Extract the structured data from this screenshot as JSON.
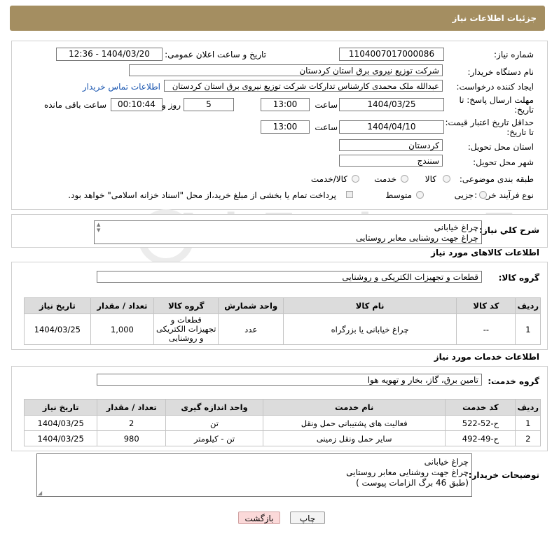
{
  "header": {
    "title": "جزئیات اطلاعات نیاز"
  },
  "watermark": {
    "text": "AriaTender.neT"
  },
  "form": {
    "need_number_label": "شماره نیاز:",
    "need_number": "1104007017000086",
    "announce_label": "تاریخ و ساعت اعلان عمومی:",
    "announce_value": "1404/03/20 - 12:36",
    "buyer_org_label": "نام دستگاه خریدار:",
    "buyer_org": "شرکت توزیع نیروی برق استان کردستان",
    "creator_label": "ایجاد کننده درخواست:",
    "creator": "عبدالله ملک محمدی کارشناس تدارکات شرکت توزیع نیروی برق استان کردستان",
    "contact_link": "اطلاعات تماس خریدار",
    "deadline_label_1": "مهلت ارسال پاسخ: تا",
    "deadline_label_2": "تاریخ:",
    "deadline_date": "1404/03/25",
    "time_label": "ساعت",
    "deadline_time": "13:00",
    "days_value": "5",
    "days_label": "روز و",
    "remaining_value": "00:10:44",
    "remaining_label": "ساعت باقی مانده",
    "validity_label_1": "حداقل تاریخ اعتبار قیمت:",
    "validity_label_2": "تا تاریخ:",
    "validity_date": "1404/04/10",
    "validity_time": "13:00",
    "province_label": "استان محل تحویل:",
    "province": "کردستان",
    "city_label": "شهر محل تحویل:",
    "city": "سنندج",
    "category_label": "طبقه بندی موضوعی:",
    "category_options": [
      "کالا",
      "خدمت",
      "کالا/خدمت"
    ],
    "process_label": "نوع فرآیند خرید :",
    "process_options": [
      "جزیی",
      "متوسط"
    ],
    "payment_note": "پرداخت تمام یا بخشی از مبلغ خرید،از محل \"اسناد خزانه اسلامی\" خواهد بود."
  },
  "summary": {
    "label": "شرح كلي نياز:",
    "line1": "چراغ خیابانی",
    "line2": "چراغ جهت روشنایی معابر روستایی"
  },
  "goods": {
    "section_title": "اطلاعات کالاهای مورد نیاز",
    "group_label": "گروه کالا:",
    "group_value": "قطعات و تجهیزات الکتریکی و روشنایی",
    "headers": [
      "ردیف",
      "کد کالا",
      "نام کالا",
      "واحد شمارش",
      "گروه کالا",
      "تعداد / مقدار",
      "تاریخ نیاز"
    ],
    "rows": [
      {
        "idx": "1",
        "code": "--",
        "name": "چراغ خیابانی یا بزرگراه",
        "unit": "عدد",
        "group": "قطعات و تجهیزات الکتریکی و روشنایی",
        "qty": "1,000",
        "date": "1404/03/25"
      }
    ]
  },
  "services": {
    "section_title": "اطلاعات خدمات مورد نیاز",
    "group_label": "گروه خدمت:",
    "group_value": "تامین برق، گاز، بخار و تهویه هوا",
    "headers": [
      "ردیف",
      "کد خدمت",
      "نام خدمت",
      "واحد اندازه گیری",
      "تعداد / مقدار",
      "تاریخ نیاز"
    ],
    "rows": [
      {
        "idx": "1",
        "code": "ح-52-522",
        "name": "فعالیت های پشتیبانی حمل ونقل",
        "unit": "تن",
        "qty": "2",
        "date": "1404/03/25"
      },
      {
        "idx": "2",
        "code": "ح-49-492",
        "name": "سایر حمل ونقل زمینی",
        "unit": "تن - کیلومتر",
        "qty": "980",
        "date": "1404/03/25"
      }
    ]
  },
  "buyer_notes": {
    "label": "توضیحات خریدار:",
    "line1": "چراغ خیابانی",
    "line2": "چراغ جهت روشنایی معابر روستایی",
    "line3": "(طبق 46 برگ الزامات پیوست )"
  },
  "buttons": {
    "print": "چاپ",
    "back": "بازگشت"
  }
}
